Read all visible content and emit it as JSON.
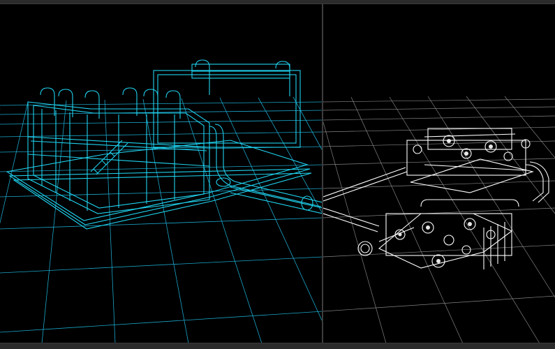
{
  "viewports": [
    {
      "id": "left",
      "render_mode": "wireframe",
      "color": "#1fd3f0",
      "grid_color": "#1fb8e0"
    },
    {
      "id": "right",
      "render_mode": "wireframe",
      "color": "#ffffff",
      "grid_color": "#9a9a9a"
    }
  ],
  "colors": {
    "background": "#000000",
    "chrome": "#2b2b2b",
    "divider": "#3d3d3d"
  }
}
